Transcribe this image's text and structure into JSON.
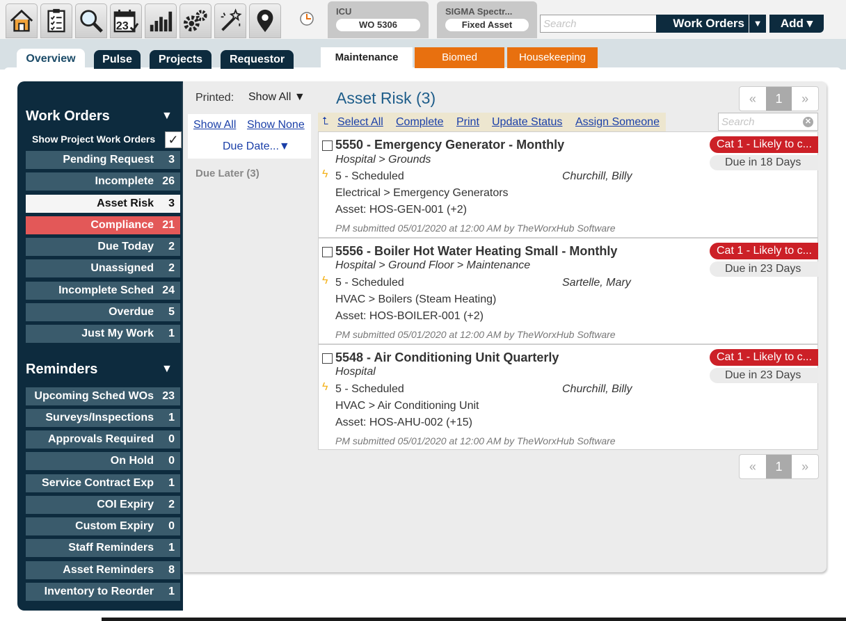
{
  "toolbar": {
    "icons": [
      "home-icon",
      "checklist-icon",
      "search-icon",
      "calendar-icon",
      "bar-chart-icon",
      "gears-icon",
      "magic-wand-icon",
      "map-pin-icon"
    ],
    "calendar_day": "23"
  },
  "context": [
    {
      "title": "ICU",
      "value": "WO 5306"
    },
    {
      "title": "SIGMA Spectr...",
      "value": "Fixed Asset"
    }
  ],
  "header": {
    "search_placeholder": "Search",
    "module_label": "Work Orders",
    "module_caret": "▼",
    "add_label": "Add ▾"
  },
  "tabs": [
    "Overview",
    "Pulse",
    "Projects",
    "Requestor"
  ],
  "module_tabs": [
    "Maintenance",
    "Biomed",
    "Housekeeping"
  ],
  "colors": {
    "navy": "#0d2b3e",
    "row": "#3a5b6c",
    "alert": "#e35858",
    "orange": "#e8700f",
    "risk": "#cc2027",
    "link": "#1a3fa8"
  },
  "sidebar": {
    "work_orders_title": "Work Orders",
    "caret": "▼",
    "show_project": "Show Project Work Orders",
    "show_project_checked": "✓",
    "work_orders": [
      {
        "label": "Pending Request",
        "count": "3"
      },
      {
        "label": "Incomplete",
        "count": "26"
      },
      {
        "label": "Asset Risk",
        "count": "3"
      },
      {
        "label": "Compliance",
        "count": "21"
      },
      {
        "label": "Due Today",
        "count": "2"
      },
      {
        "label": "Unassigned",
        "count": "2"
      },
      {
        "label": "Incomplete Sched",
        "count": "24"
      },
      {
        "label": "Overdue",
        "count": "5"
      },
      {
        "label": "Just My Work",
        "count": "1"
      }
    ],
    "reminders_title": "Reminders",
    "reminders": [
      {
        "label": "Upcoming Sched WOs",
        "count": "23"
      },
      {
        "label": "Surveys/Inspections",
        "count": "1"
      },
      {
        "label": "Approvals Required",
        "count": "0"
      },
      {
        "label": "On Hold",
        "count": "0"
      },
      {
        "label": "Service Contract Exp",
        "count": "1"
      },
      {
        "label": "COI Expiry",
        "count": "2"
      },
      {
        "label": "Custom Expiry",
        "count": "0"
      },
      {
        "label": "Staff Reminders",
        "count": "1"
      },
      {
        "label": "Asset Reminders",
        "count": "8"
      },
      {
        "label": "Inventory to Reorder",
        "count": "1"
      }
    ]
  },
  "filters": {
    "printed_label": "Printed:",
    "printed_value": "Show All ▼",
    "show_all": "Show All",
    "show_none": "Show None",
    "due_date": "Due Date...▼",
    "due_later": "Due Later (3)"
  },
  "list": {
    "title": "Asset Risk (3)",
    "pager": {
      "prev": "«",
      "page": "1",
      "next": "»"
    },
    "actions": [
      "Select All",
      "Complete",
      "Print",
      "Update Status",
      "Assign Someone"
    ],
    "search_placeholder": "Search",
    "search_clear": "✕",
    "items": [
      {
        "title": "5550 - Emergency Generator - Monthly",
        "location": "Hospital > Grounds",
        "priority": "5 - Scheduled",
        "assignee": "Churchill, Billy",
        "category": "Electrical > Emergency Generators",
        "asset": "Asset: HOS-GEN-001 (+2)",
        "submitted": "PM submitted 05/01/2020 at 12:00 AM by TheWorxHub Software",
        "risk": "Cat 1 - Likely to c...",
        "due": "Due in 18 Days"
      },
      {
        "title": "5556 - Boiler Hot Water Heating Small - Monthly",
        "location": "Hospital > Ground Floor > Maintenance",
        "priority": "5 - Scheduled",
        "assignee": "Sartelle, Mary",
        "category": "HVAC > Boilers (Steam Heating)",
        "asset": "Asset: HOS-BOILER-001 (+2)",
        "submitted": "PM submitted 05/01/2020 at 12:00 AM by TheWorxHub Software",
        "risk": "Cat 1 - Likely to c...",
        "due": "Due in 23 Days"
      },
      {
        "title": "5548 - Air Conditioning Unit Quarterly",
        "location": "Hospital",
        "priority": "5 - Scheduled",
        "assignee": "Churchill, Billy",
        "category": "HVAC > Air Conditioning Unit",
        "asset": "Asset: HOS-AHU-002 (+15)",
        "submitted": "PM submitted 05/01/2020 at 12:00 AM by TheWorxHub Software",
        "risk": "Cat 1 - Likely to c...",
        "due": "Due in 23 Days"
      }
    ]
  }
}
